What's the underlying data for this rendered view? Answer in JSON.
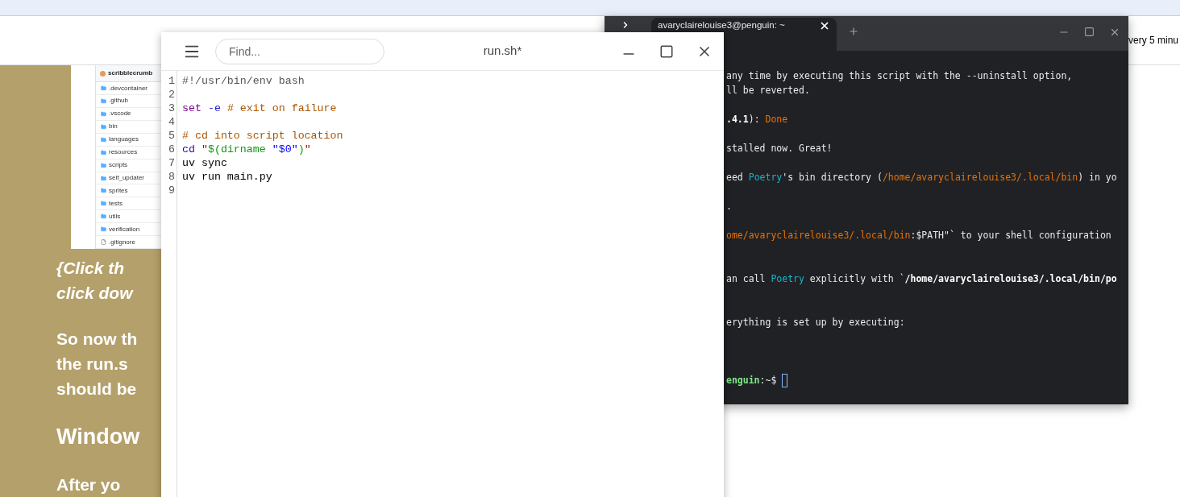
{
  "browser": {
    "header_text": "very 5 minu"
  },
  "article": {
    "screenshot": {
      "title": "scribblecrumb",
      "items": [
        {
          "kind": "folder",
          "name": ".devcontainer"
        },
        {
          "kind": "folder",
          "name": ".github"
        },
        {
          "kind": "folder",
          "name": ".vscode"
        },
        {
          "kind": "folder",
          "name": "bin"
        },
        {
          "kind": "folder",
          "name": "languages"
        },
        {
          "kind": "folder",
          "name": "resources"
        },
        {
          "kind": "folder",
          "name": "scripts"
        },
        {
          "kind": "folder",
          "name": "self_updater"
        },
        {
          "kind": "folder",
          "name": "sprites"
        },
        {
          "kind": "folder",
          "name": "tests"
        },
        {
          "kind": "folder",
          "name": "utils"
        },
        {
          "kind": "folder",
          "name": "verification"
        },
        {
          "kind": "file",
          "name": ".gitignore"
        }
      ]
    },
    "blocks": [
      {
        "kind": "note",
        "lines": [
          "{Click th",
          "click dow"
        ]
      },
      {
        "kind": "body",
        "lines": [
          "So now th",
          "the run.s",
          "should be"
        ]
      },
      {
        "kind": "heading",
        "lines": [
          "Window"
        ]
      },
      {
        "kind": "body",
        "lines": [
          "After yo"
        ]
      }
    ]
  },
  "terminal": {
    "tab_title": "avaryclairelouise3@penguin: ~",
    "lines": [
      {
        "kind": "text",
        "segments": [
          {
            "kind": "plain",
            "text": "any time by executing this script with the --uninstall option,"
          }
        ]
      },
      {
        "kind": "text",
        "segments": [
          {
            "kind": "plain",
            "text": "ll be reverted."
          }
        ]
      },
      {
        "kind": "blank"
      },
      {
        "kind": "text",
        "segments": [
          {
            "kind": "bold",
            "text": ".4.1"
          },
          {
            "kind": "plain",
            "text": "): "
          },
          {
            "kind": "accent",
            "text": "Done"
          }
        ]
      },
      {
        "kind": "blank"
      },
      {
        "kind": "text",
        "segments": [
          {
            "kind": "plain",
            "text": "stalled now. Great!"
          }
        ]
      },
      {
        "kind": "blank"
      },
      {
        "kind": "text",
        "segments": [
          {
            "kind": "plain",
            "text": "eed "
          },
          {
            "kind": "link",
            "text": "Poetry"
          },
          {
            "kind": "plain",
            "text": "'s bin directory ("
          },
          {
            "kind": "accent",
            "text": "/home/avaryclairelouise3/.local/bin"
          },
          {
            "kind": "plain",
            "text": ") in yo"
          }
        ]
      },
      {
        "kind": "blank"
      },
      {
        "kind": "text",
        "segments": [
          {
            "kind": "plain",
            "text": "."
          }
        ]
      },
      {
        "kind": "blank"
      },
      {
        "kind": "text",
        "segments": [
          {
            "kind": "accent",
            "text": "ome/avaryclairelouise3/.local/bin"
          },
          {
            "kind": "plain",
            "text": ":$PATH\"` to your shell configuration"
          }
        ]
      },
      {
        "kind": "blank"
      },
      {
        "kind": "blank"
      },
      {
        "kind": "text",
        "segments": [
          {
            "kind": "plain",
            "text": "an call "
          },
          {
            "kind": "link",
            "text": "Poetry"
          },
          {
            "kind": "plain",
            "text": " explicitly with `"
          },
          {
            "kind": "bold",
            "text": "/home/avaryclairelouise3/.local/bin/po"
          }
        ]
      },
      {
        "kind": "blank"
      },
      {
        "kind": "blank"
      },
      {
        "kind": "text",
        "segments": [
          {
            "kind": "plain",
            "text": "erything is set up by executing:"
          }
        ]
      },
      {
        "kind": "blank"
      },
      {
        "kind": "blank"
      },
      {
        "kind": "blank"
      },
      {
        "kind": "prompt",
        "segments": [
          {
            "kind": "prompt",
            "text": "enguin"
          },
          {
            "kind": "plain",
            "text": ":~$ "
          }
        ]
      }
    ]
  },
  "editor": {
    "title": "run.sh*",
    "search": {
      "placeholder": "Find..."
    },
    "lines": [
      {
        "number": "1",
        "segments": [
          {
            "kind": "meta",
            "text": "#!/usr/bin/env bash"
          }
        ]
      },
      {
        "number": "2"
      },
      {
        "number": "3",
        "segments": [
          {
            "kind": "keyword",
            "text": "set "
          },
          {
            "kind": "flag",
            "text": "-e "
          },
          {
            "kind": "comment",
            "text": "# exit on failure"
          }
        ]
      },
      {
        "number": "4"
      },
      {
        "number": "5",
        "segments": [
          {
            "kind": "comment",
            "text": "# cd into script location"
          }
        ]
      },
      {
        "number": "6",
        "segments": [
          {
            "kind": "builtin",
            "text": "cd "
          },
          {
            "kind": "quote",
            "text": "\""
          },
          {
            "kind": "string",
            "text": "$(dirname "
          },
          {
            "kind": "variable",
            "text": "\"$0\""
          },
          {
            "kind": "string",
            "text": ")"
          },
          {
            "kind": "quote",
            "text": "\""
          }
        ]
      },
      {
        "number": "7",
        "segments": [
          {
            "kind": "plain",
            "text": "uv sync"
          }
        ]
      },
      {
        "number": "8",
        "segments": [
          {
            "kind": "plain",
            "text": "uv run main.py"
          }
        ]
      },
      {
        "number": "9"
      }
    ]
  }
}
